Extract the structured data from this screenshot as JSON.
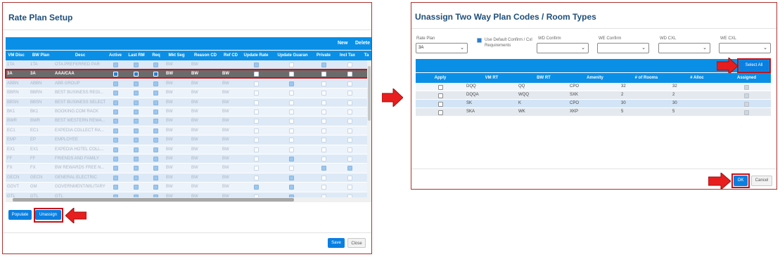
{
  "left": {
    "title": "Rate Plan Setup",
    "toolbar": {
      "new_label": "New",
      "delete_label": "Delete"
    },
    "columns": [
      "VM Disc",
      "BW Plan",
      "Desc",
      "Active",
      "Last RM",
      "Req",
      "Mkt Seg",
      "Reason CD",
      "Ref CD",
      "Update Rate",
      "Update Guaran",
      "Private",
      "Incl Tax",
      "Ta"
    ],
    "rows": [
      {
        "vm": "1TA",
        "bw": "1TA",
        "desc": "OTA PREFERRED PAR",
        "active": true,
        "last": true,
        "req": true,
        "mkt": "BW",
        "reason": "BW",
        "ref": "",
        "update_rate": true,
        "guar": false,
        "private": true,
        "incl": false
      },
      {
        "vm": "3A",
        "bw": "3A",
        "desc": "AAA/CAA",
        "active": true,
        "last": true,
        "req": true,
        "mkt": "BW",
        "reason": "BW",
        "ref": "BW",
        "update_rate": false,
        "guar": false,
        "private": false,
        "incl": false
      },
      {
        "vm": "ABBN",
        "bw": "ABBN",
        "desc": "ABB GROUP",
        "active": true,
        "last": true,
        "req": true,
        "mkt": "BW",
        "reason": "BW",
        "ref": "BW",
        "update_rate": false,
        "guar": true,
        "private": false,
        "incl": false
      },
      {
        "vm": "BBRN",
        "bw": "BBRN",
        "desc": "BEST BUSINESS REGI...",
        "active": true,
        "last": true,
        "req": true,
        "mkt": "BW",
        "reason": "BW",
        "ref": "BW",
        "update_rate": false,
        "guar": false,
        "private": false,
        "incl": false
      },
      {
        "vm": "BBSN",
        "bw": "BBSN",
        "desc": "BEST BUSINESS SELECT",
        "active": true,
        "last": true,
        "req": true,
        "mkt": "BW",
        "reason": "BW",
        "ref": "BW",
        "update_rate": false,
        "guar": false,
        "private": false,
        "incl": false
      },
      {
        "vm": "BK1",
        "bw": "BK1",
        "desc": "BOOKING.COM RACK",
        "active": true,
        "last": true,
        "req": true,
        "mkt": "BW",
        "reason": "BW",
        "ref": "BW",
        "update_rate": false,
        "guar": false,
        "private": false,
        "incl": false
      },
      {
        "vm": "BWR",
        "bw": "BWR",
        "desc": "BEST WESTERN REWA...",
        "active": true,
        "last": true,
        "req": true,
        "mkt": "BW",
        "reason": "BW",
        "ref": "BW",
        "update_rate": false,
        "guar": false,
        "private": false,
        "incl": false
      },
      {
        "vm": "EC1",
        "bw": "EC1",
        "desc": "EXPEDIA COLLECT RA...",
        "active": true,
        "last": true,
        "req": true,
        "mkt": "BW",
        "reason": "BW",
        "ref": "BW",
        "update_rate": false,
        "guar": false,
        "private": false,
        "incl": false
      },
      {
        "vm": "EMP",
        "bw": "EP",
        "desc": "EMPLOYEE",
        "active": true,
        "last": true,
        "req": true,
        "mkt": "BW",
        "reason": "BW",
        "ref": "BW",
        "update_rate": false,
        "guar": false,
        "private": false,
        "incl": false
      },
      {
        "vm": "EX1",
        "bw": "EX1",
        "desc": "EXPEDIA HOTEL COLL...",
        "active": true,
        "last": true,
        "req": true,
        "mkt": "BW",
        "reason": "BW",
        "ref": "BW",
        "update_rate": false,
        "guar": false,
        "private": false,
        "incl": false
      },
      {
        "vm": "FF",
        "bw": "FF",
        "desc": "FRIENDS AND FAMILY",
        "active": true,
        "last": true,
        "req": true,
        "mkt": "BW",
        "reason": "BW",
        "ref": "BW",
        "update_rate": false,
        "guar": true,
        "private": false,
        "incl": false
      },
      {
        "vm": "FX",
        "bw": "FX",
        "desc": "BW REWARDS FREE N...",
        "active": true,
        "last": true,
        "req": true,
        "mkt": "BW",
        "reason": "BW",
        "ref": "BW",
        "update_rate": false,
        "guar": false,
        "private": true,
        "incl": true
      },
      {
        "vm": "GECN",
        "bw": "GECN",
        "desc": "GENERAL ELECTRIC",
        "active": true,
        "last": true,
        "req": true,
        "mkt": "BW",
        "reason": "BW",
        "ref": "BW",
        "update_rate": false,
        "guar": true,
        "private": false,
        "incl": false
      },
      {
        "vm": "GOVT",
        "bw": "GM",
        "desc": "GOVERNMENT/MILITARY",
        "active": true,
        "last": true,
        "req": true,
        "mkt": "BW",
        "reason": "BW",
        "ref": "BW",
        "update_rate": true,
        "guar": true,
        "private": false,
        "incl": false
      },
      {
        "vm": "GTL",
        "bw": "GTL",
        "desc": "GTL",
        "active": true,
        "last": true,
        "req": true,
        "mkt": "BW",
        "reason": "BW",
        "ref": "BW",
        "update_rate": false,
        "guar": true,
        "private": false,
        "incl": false
      }
    ],
    "populate_label": "Populate",
    "unassign_label": "Unassign",
    "save_label": "Save",
    "close_label": "Close"
  },
  "right": {
    "title": "Unassign Two Way Plan Codes / Room Types",
    "rate_plan_label": "Rate Plan",
    "rate_plan_value": "3A",
    "use_default_label": "Use Default Confirm / Cxl Requirements",
    "use_default_checked": true,
    "wd_confirm_label": "WD Confirm",
    "we_confirm_label": "WE Confirm",
    "wd_cxl_label": "WD CXL",
    "we_cxl_label": "WE CXL",
    "select_all_label": "Select All",
    "columns": [
      "Apply",
      "VM RT",
      "BW RT",
      "Amenity",
      "# of Rooms",
      "# Alloc",
      "Assigned"
    ],
    "rows": [
      {
        "vm": "DQQ",
        "bw": "QQ",
        "amenity": "CPO",
        "rooms": "32",
        "alloc": "32"
      },
      {
        "vm": "DQQA",
        "bw": "WQQ",
        "amenity": "SXK",
        "rooms": "2",
        "alloc": "2"
      },
      {
        "vm": "SK",
        "bw": "K",
        "amenity": "CPO",
        "rooms": "30",
        "alloc": "30"
      },
      {
        "vm": "SKA",
        "bw": "WK",
        "amenity": "XKP",
        "rooms": "5",
        "alloc": "5"
      }
    ],
    "ok_label": "OK",
    "cancel_label": "Cancel"
  },
  "colors": {
    "header_blue": "#0a8fe6",
    "highlight_red": "#c0141c",
    "selected_row": "#6b6b6b"
  }
}
